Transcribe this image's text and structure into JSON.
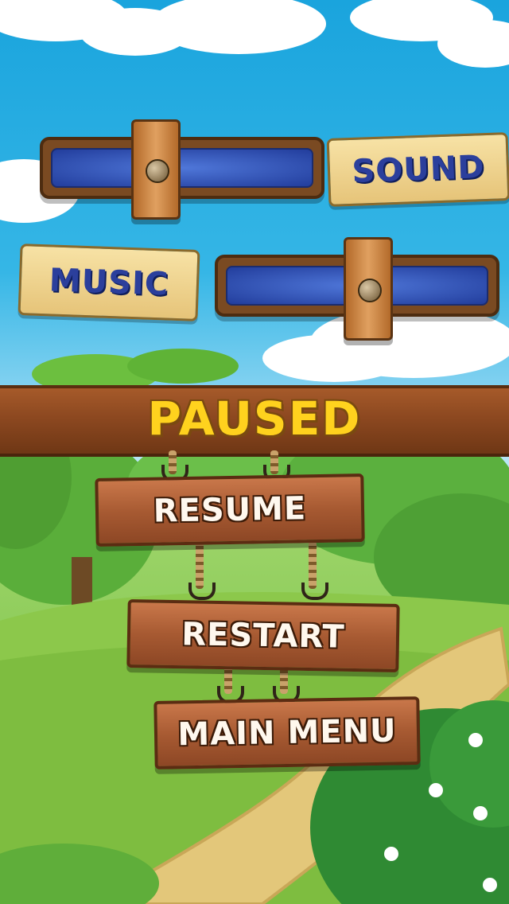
{
  "screen": {
    "title": "PAUSED"
  },
  "sound": {
    "label": "SOUND"
  },
  "music": {
    "label": "MUSIC"
  },
  "menu": {
    "resume": "RESUME",
    "restart": "RESTART",
    "main_menu": "MAIN MENU"
  },
  "colors": {
    "title": "#ffd21e",
    "tag_text": "#2b3f9c",
    "wood": "#a75a32",
    "sky": "#1aa4dd",
    "grass": "#6cbc3a"
  },
  "icons": [
    "cloud",
    "bush",
    "tree",
    "path",
    "flower",
    "rope",
    "hook",
    "bolt"
  ]
}
